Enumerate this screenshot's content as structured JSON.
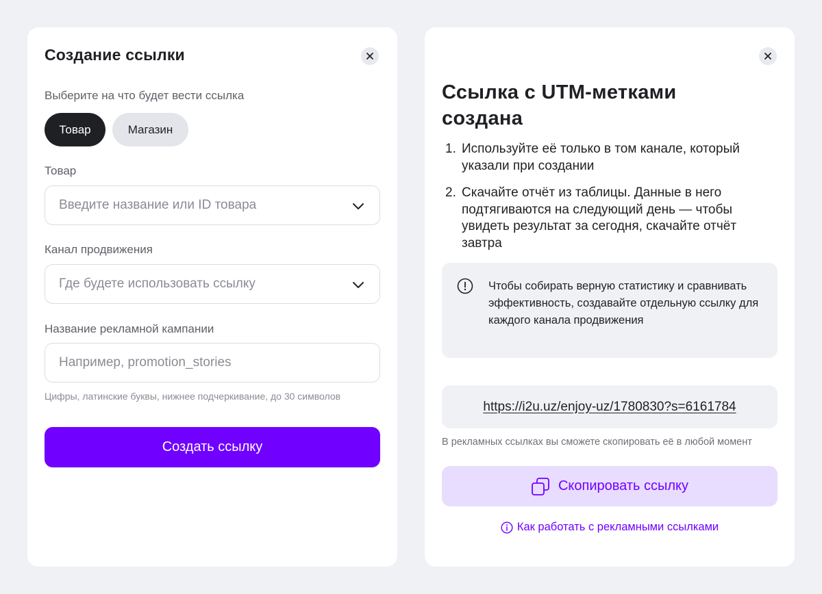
{
  "create_form": {
    "title": "Создание ссылки",
    "close_icon": "close-icon",
    "target_prompt": "Выберите на что будет вести ссылка",
    "target_options": [
      {
        "label": "Товар",
        "selected": true
      },
      {
        "label": "Магазин",
        "selected": false
      }
    ],
    "product_label": "Товар",
    "product_placeholder": "Введите название или ID товара",
    "channel_label": "Канал продвижения",
    "channel_placeholder": "Где будете использовать ссылку",
    "campaign_label": "Название рекламной кампании",
    "campaign_placeholder": "Например, promotion_stories",
    "campaign_hint": "Цифры, латинские буквы, нижнее подчеркивание, до 30 символов",
    "submit_label": "Создать ссылку"
  },
  "result_panel": {
    "title": "Ссылка с UTM-метками создана",
    "close_icon": "close-icon",
    "steps": [
      {
        "num": "1.",
        "text": "Используйте её только в том канале, который указали при создании"
      },
      {
        "num": "2.",
        "text": "Скачайте отчёт из таблицы. Данные в него подтягиваются на следующий день — чтобы увидеть результат за сегодня, скачайте отчёт завтра"
      }
    ],
    "info_icon": "exclamation-circle-icon",
    "info_text": "Чтобы собирать верную статистику и сравнивать эффективность, создавайте отдельную ссылку для каждого канала продвижения",
    "generated_link": "https://i2u.uz/enjoy-uz/1780830?s=6161784",
    "copy_note": "В рекламных ссылках вы сможете скопировать её в любой момент",
    "copy_label": "Скопировать ссылку",
    "copy_icon": "copy-icon",
    "help_label": "Как работать с рекламными ссылками",
    "help_icon": "info-icon"
  },
  "colors": {
    "accent": "#7000ff",
    "accent_light": "#e8dcff",
    "background": "#f0f1f5",
    "text": "#1f2024"
  }
}
